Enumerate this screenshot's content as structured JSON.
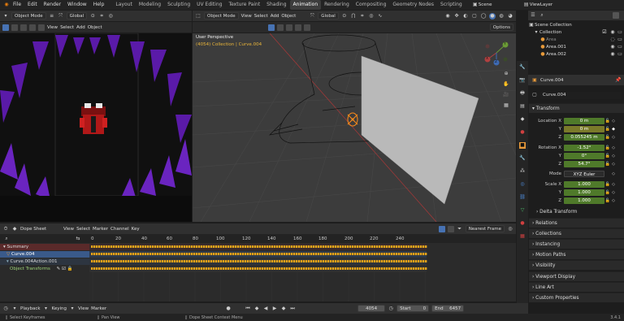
{
  "topbar": {
    "menus": [
      "File",
      "Edit",
      "Render",
      "Window",
      "Help"
    ],
    "workspaces": [
      "Layout",
      "Modeling",
      "Sculpting",
      "UV Editing",
      "Texture Paint",
      "Shading",
      "Animation",
      "Rendering",
      "Compositing",
      "Geometry Nodes",
      "Scripting"
    ],
    "active_workspace": "Animation",
    "scene": "Scene",
    "view_layer": "ViewLayer"
  },
  "camera_view": {
    "mode": "Object Mode",
    "transform": "Global",
    "menus": [
      "View",
      "Select",
      "Add",
      "Object"
    ]
  },
  "viewport": {
    "mode": "Object Mode",
    "menus": [
      "View",
      "Select",
      "Add",
      "Object"
    ],
    "transform": "Global",
    "options": "Options",
    "overlay_title": "User Perspective",
    "overlay_subtitle": "(4054) Collection | Curve.004",
    "axis_labels": [
      "Y",
      "X",
      "Z"
    ]
  },
  "outliner": {
    "rows": [
      {
        "label": "Scene Collection"
      },
      {
        "label": "Collection"
      },
      {
        "label": "Area"
      },
      {
        "label": "Area.001"
      },
      {
        "label": "Area.002"
      }
    ]
  },
  "properties": {
    "object_name": "Curve.004",
    "data_name": "Curve.004",
    "transform_header": "Transform",
    "location": {
      "label": "Location X",
      "x": "0 m",
      "y": "0 m",
      "z": "0.055245 m"
    },
    "rotation": {
      "label": "Rotation X",
      "x": "-1.52°",
      "y": "0°",
      "z": "54.7°"
    },
    "mode_label": "Mode",
    "mode_value": "XYZ Euler",
    "scale": {
      "label": "Scale X",
      "x": "1.000",
      "y": "1.000",
      "z": "1.000"
    },
    "axis_y": "Y",
    "axis_z": "Z",
    "sections": [
      "Delta Transform",
      "Relations",
      "Collections",
      "Instancing",
      "Motion Paths",
      "Visibility",
      "Viewport Display",
      "Line Art",
      "Custom Properties"
    ]
  },
  "dopesheet": {
    "mode": "Dope Sheet",
    "menus": [
      "View",
      "Select",
      "Marker",
      "Channel",
      "Key"
    ],
    "interpolation": "Nearest Frame",
    "channels": [
      {
        "label": "Summary"
      },
      {
        "label": "Curve.004"
      },
      {
        "label": "Curve.004Action.001"
      },
      {
        "label": "Object Transforms"
      }
    ],
    "frames": [
      "0",
      "20",
      "40",
      "60",
      "80",
      "100",
      "120",
      "140",
      "160",
      "180",
      "200",
      "220",
      "240"
    ]
  },
  "timeline": {
    "menus": [
      "Playback",
      "Keying",
      "View",
      "Marker"
    ],
    "current_frame": "4054",
    "start_label": "Start",
    "start": "0",
    "end_label": "End",
    "end": "6457"
  },
  "statusbar": {
    "left": "Select Keyframes",
    "middle": "Pan View",
    "context": "Dope Sheet Context Menu",
    "version": "3.4.1"
  }
}
